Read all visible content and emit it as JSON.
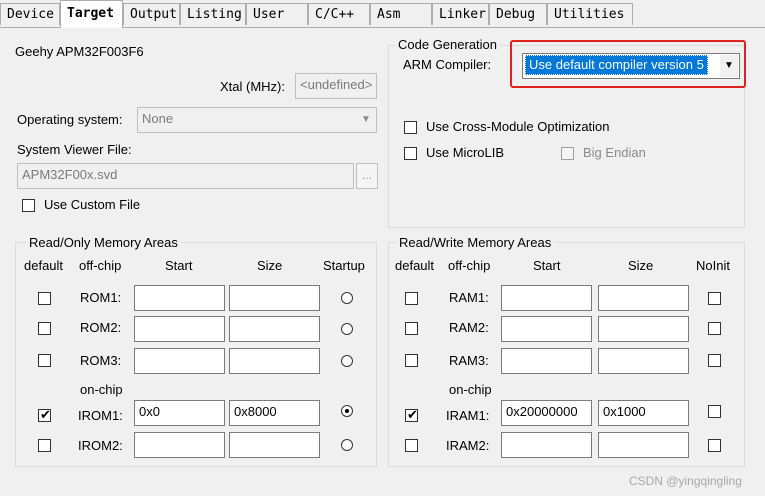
{
  "tabs": [
    "Device",
    "Target",
    "Output",
    "Listing",
    "User",
    "C/C++",
    "Asm",
    "Linker",
    "Debug",
    "Utilities"
  ],
  "active_tab": "Target",
  "device_name": "Geehy APM32F003F6",
  "xtal": {
    "label": "Xtal (MHz):",
    "value": "<undefined>"
  },
  "os": {
    "label": "Operating system:",
    "value": "None"
  },
  "svf": {
    "label": "System Viewer File:",
    "value": "APM32F00x.svd",
    "browse": "..."
  },
  "custom_file": "Use Custom File",
  "code_gen": {
    "title": "Code Generation",
    "compiler_label": "ARM Compiler:",
    "compiler_value": "Use default compiler version 5",
    "cross_module": "Use Cross-Module Optimization",
    "microlib": "Use MicroLIB",
    "big_endian": "Big Endian"
  },
  "ro_mem": {
    "title": "Read/Only Memory Areas",
    "headers": {
      "default": "default",
      "offchip": "off-chip",
      "start": "Start",
      "size": "Size",
      "startup": "Startup"
    },
    "onchip_label": "on-chip",
    "rows": [
      {
        "label": "ROM1:",
        "start": "",
        "size": ""
      },
      {
        "label": "ROM2:",
        "start": "",
        "size": ""
      },
      {
        "label": "ROM3:",
        "start": "",
        "size": ""
      },
      {
        "label": "IROM1:",
        "start": "0x0",
        "size": "0x8000"
      },
      {
        "label": "IROM2:",
        "start": "",
        "size": ""
      }
    ]
  },
  "rw_mem": {
    "title": "Read/Write Memory Areas",
    "headers": {
      "default": "default",
      "offchip": "off-chip",
      "start": "Start",
      "size": "Size",
      "noinit": "NoInit"
    },
    "onchip_label": "on-chip",
    "rows": [
      {
        "label": "RAM1:",
        "start": "",
        "size": ""
      },
      {
        "label": "RAM2:",
        "start": "",
        "size": ""
      },
      {
        "label": "RAM3:",
        "start": "",
        "size": ""
      },
      {
        "label": "IRAM1:",
        "start": "0x20000000",
        "size": "0x1000"
      },
      {
        "label": "IRAM2:",
        "start": "",
        "size": ""
      }
    ]
  },
  "checks": {
    "glyph": "✔"
  },
  "watermark": "CSDN @yingqingling",
  "colors": {
    "highlight": "#0078d7",
    "annotation": "#e0211f"
  }
}
